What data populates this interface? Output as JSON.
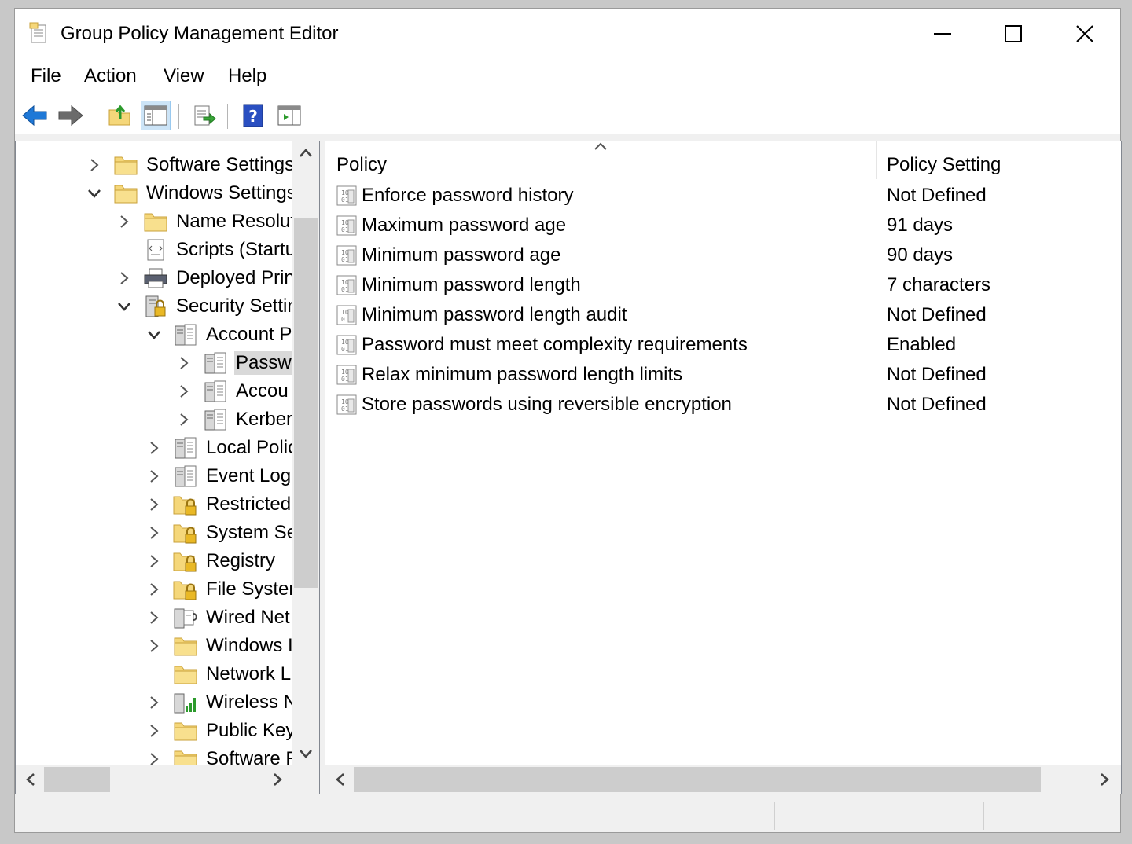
{
  "window": {
    "title": "Group Policy Management Editor",
    "controls": [
      "minimize",
      "maximize",
      "close"
    ]
  },
  "menu": [
    "File",
    "Action",
    "View",
    "Help"
  ],
  "toolbar": {
    "buttons": [
      {
        "name": "back-button",
        "icon": "back-arrow-icon"
      },
      {
        "name": "forward-button",
        "icon": "forward-arrow-icon"
      },
      {
        "name": "up-one-level-button",
        "icon": "folder-up-icon"
      },
      {
        "name": "show-hide-console-tree-button",
        "icon": "console-tree-icon",
        "active": true
      },
      {
        "name": "export-list-button",
        "icon": "export-list-icon"
      },
      {
        "name": "help-button",
        "icon": "help-icon"
      },
      {
        "name": "show-hide-action-pane-button",
        "icon": "action-pane-icon"
      }
    ]
  },
  "tree": {
    "items": [
      {
        "label": "Software Settings",
        "expander": "collapsed",
        "icon": "folder-icon",
        "level": 0
      },
      {
        "label": "Windows Settings",
        "expander": "expanded",
        "icon": "folder-icon",
        "level": 0
      },
      {
        "label": "Name Resolut",
        "expander": "collapsed",
        "icon": "folder-icon",
        "level": 1
      },
      {
        "label": "Scripts (Startu",
        "expander": "none",
        "icon": "scripts-icon",
        "level": 1
      },
      {
        "label": "Deployed Prin",
        "expander": "collapsed",
        "icon": "printer-icon",
        "level": 1
      },
      {
        "label": "Security Settir",
        "expander": "expanded",
        "icon": "security-settings-icon",
        "level": 1
      },
      {
        "label": "Account P",
        "expander": "expanded",
        "icon": "policy-server-icon",
        "level": 2
      },
      {
        "label": "Passwo",
        "expander": "collapsed",
        "icon": "policy-server-icon",
        "level": 3,
        "selected": true
      },
      {
        "label": "Accou",
        "expander": "collapsed",
        "icon": "policy-server-icon",
        "level": 3
      },
      {
        "label": "Kerber",
        "expander": "collapsed",
        "icon": "policy-server-icon",
        "level": 3
      },
      {
        "label": "Local Polic",
        "expander": "collapsed",
        "icon": "policy-server-icon",
        "level": 2
      },
      {
        "label": "Event Log",
        "expander": "collapsed",
        "icon": "policy-server-icon",
        "level": 2
      },
      {
        "label": "Restricted",
        "expander": "collapsed",
        "icon": "locked-folder-icon",
        "level": 2
      },
      {
        "label": "System Se",
        "expander": "collapsed",
        "icon": "locked-folder-icon",
        "level": 2
      },
      {
        "label": "Registry",
        "expander": "collapsed",
        "icon": "locked-folder-icon",
        "level": 2
      },
      {
        "label": "File Systen",
        "expander": "collapsed",
        "icon": "locked-folder-icon",
        "level": 2
      },
      {
        "label": "Wired Net",
        "expander": "collapsed",
        "icon": "wired-network-icon",
        "level": 2
      },
      {
        "label": "Windows I",
        "expander": "collapsed",
        "icon": "folder-icon",
        "level": 2
      },
      {
        "label": "Network L",
        "expander": "none",
        "icon": "folder-icon",
        "level": 2
      },
      {
        "label": "Wireless N",
        "expander": "collapsed",
        "icon": "wireless-network-icon",
        "level": 2
      },
      {
        "label": "Public Key",
        "expander": "collapsed",
        "icon": "folder-icon",
        "level": 2
      },
      {
        "label": "Software R",
        "expander": "collapsed",
        "icon": "folder-icon",
        "level": 2
      }
    ]
  },
  "list": {
    "columns": [
      "Policy",
      "Policy Setting"
    ],
    "sort_column": "Policy",
    "sort_direction": "ascending",
    "rows": [
      {
        "policy": "Enforce password history",
        "setting": "Not Defined"
      },
      {
        "policy": "Maximum password age",
        "setting": "91 days"
      },
      {
        "policy": "Minimum password age",
        "setting": "90 days"
      },
      {
        "policy": "Minimum password length",
        "setting": "7 characters"
      },
      {
        "policy": "Minimum password length audit",
        "setting": "Not Defined"
      },
      {
        "policy": "Password must meet complexity requirements",
        "setting": "Enabled"
      },
      {
        "policy": "Relax minimum password length limits",
        "setting": "Not Defined"
      },
      {
        "policy": "Store passwords using reversible encryption",
        "setting": "Not Defined"
      }
    ]
  },
  "colors": {
    "folder": "#f5d77a",
    "folder_border": "#c9a13a",
    "nav_arrow_blue": "#1e78d7",
    "selection": "#d9d9d9",
    "toolbar_active": "#cce4f7"
  }
}
